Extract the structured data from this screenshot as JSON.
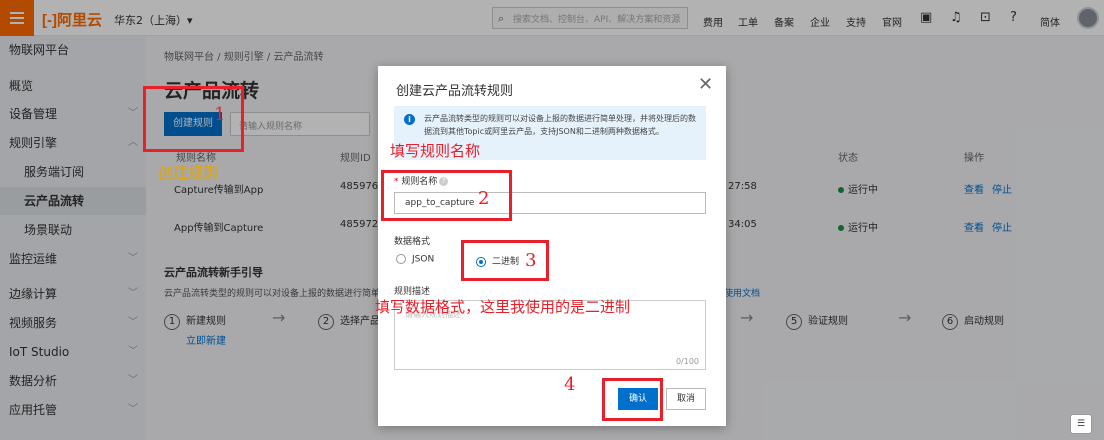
{
  "topbar": {
    "logo": "[-]阿里云",
    "region": "华东2（上海）▾",
    "search_placeholder": "搜索文档、控制台、API、解决方案和资源",
    "nav": [
      "费用",
      "工单",
      "备案",
      "企业",
      "支持",
      "官网"
    ],
    "lang": "简体"
  },
  "sidebar": {
    "title": "物联网平台",
    "items": [
      {
        "label": "概览"
      },
      {
        "label": "设备管理",
        "chevron": "﹀"
      },
      {
        "label": "规则引擎",
        "chevron": "︿"
      },
      {
        "label": "服务端订阅"
      },
      {
        "label": "云产品流转"
      },
      {
        "label": "场景联动"
      },
      {
        "label": "监控运维",
        "chevron": "﹀"
      },
      {
        "label": "边缘计算",
        "chevron": "﹀"
      },
      {
        "label": "视频服务",
        "chevron": "﹀"
      },
      {
        "label": "IoT Studio",
        "chevron": "﹀"
      },
      {
        "label": "数据分析",
        "chevron": "﹀"
      },
      {
        "label": "应用托管",
        "chevron": "﹀"
      }
    ]
  },
  "main": {
    "breadcrumb": "物联网平台 / 规则引擎 / 云产品流转",
    "title": "云产品流转",
    "create_button": "创建规则",
    "search_placeholder": "请输入规则名称",
    "columns": {
      "name": "规则名称",
      "id": "规则ID",
      "status": "状态",
      "ops": "操作"
    },
    "rows": [
      {
        "name": "Capture传输到App",
        "id": "485976",
        "time": "27:58",
        "status": "运行中",
        "view": "查看",
        "stop": "停止"
      },
      {
        "name": "App传输到Capture",
        "id": "485972",
        "time": "34:05",
        "status": "运行中",
        "view": "查看",
        "stop": "停止"
      }
    ],
    "guide_title": "云产品流转新手引导",
    "guide_desc": "云产品流转类型的规则可以对设备上报的数据进行简单处",
    "guide_doc": "使用文档",
    "steps": [
      {
        "num": "1",
        "label": "新建规则"
      },
      {
        "num": "2",
        "label": "选择产品"
      },
      {
        "num": "5",
        "label": "验证规则"
      },
      {
        "num": "6",
        "label": "启动规则"
      }
    ],
    "create_now": "立即新建"
  },
  "modal": {
    "title": "创建云产品流转规则",
    "tip": "云产品流转类型的规则可以对设备上报的数据进行简单处理，并将处理后的数据流到其他Topic或阿里云产品，支持JSON和二进制两种数据格式。",
    "name_label": "规则名称",
    "name_value": "app_to_capture",
    "format_label": "数据格式",
    "format_options": [
      "JSON",
      "二进制"
    ],
    "format_selected": "二进制",
    "desc_label": "规则描述",
    "desc_placeholder": "请输入规则描述",
    "desc_counter": "0/100",
    "ok": "确认",
    "cancel": "取消"
  },
  "annotations": {
    "a1": "1",
    "a1_text": "创建规则",
    "a2_text": "填写规则名称",
    "a2": "2",
    "a3": "3",
    "a3_text": "填写数据格式，这里我使用的是二进制",
    "a4": "4"
  },
  "colors": {
    "brand": "#ff6a00",
    "primary": "#0070cc",
    "annotation": "#e8202a"
  }
}
